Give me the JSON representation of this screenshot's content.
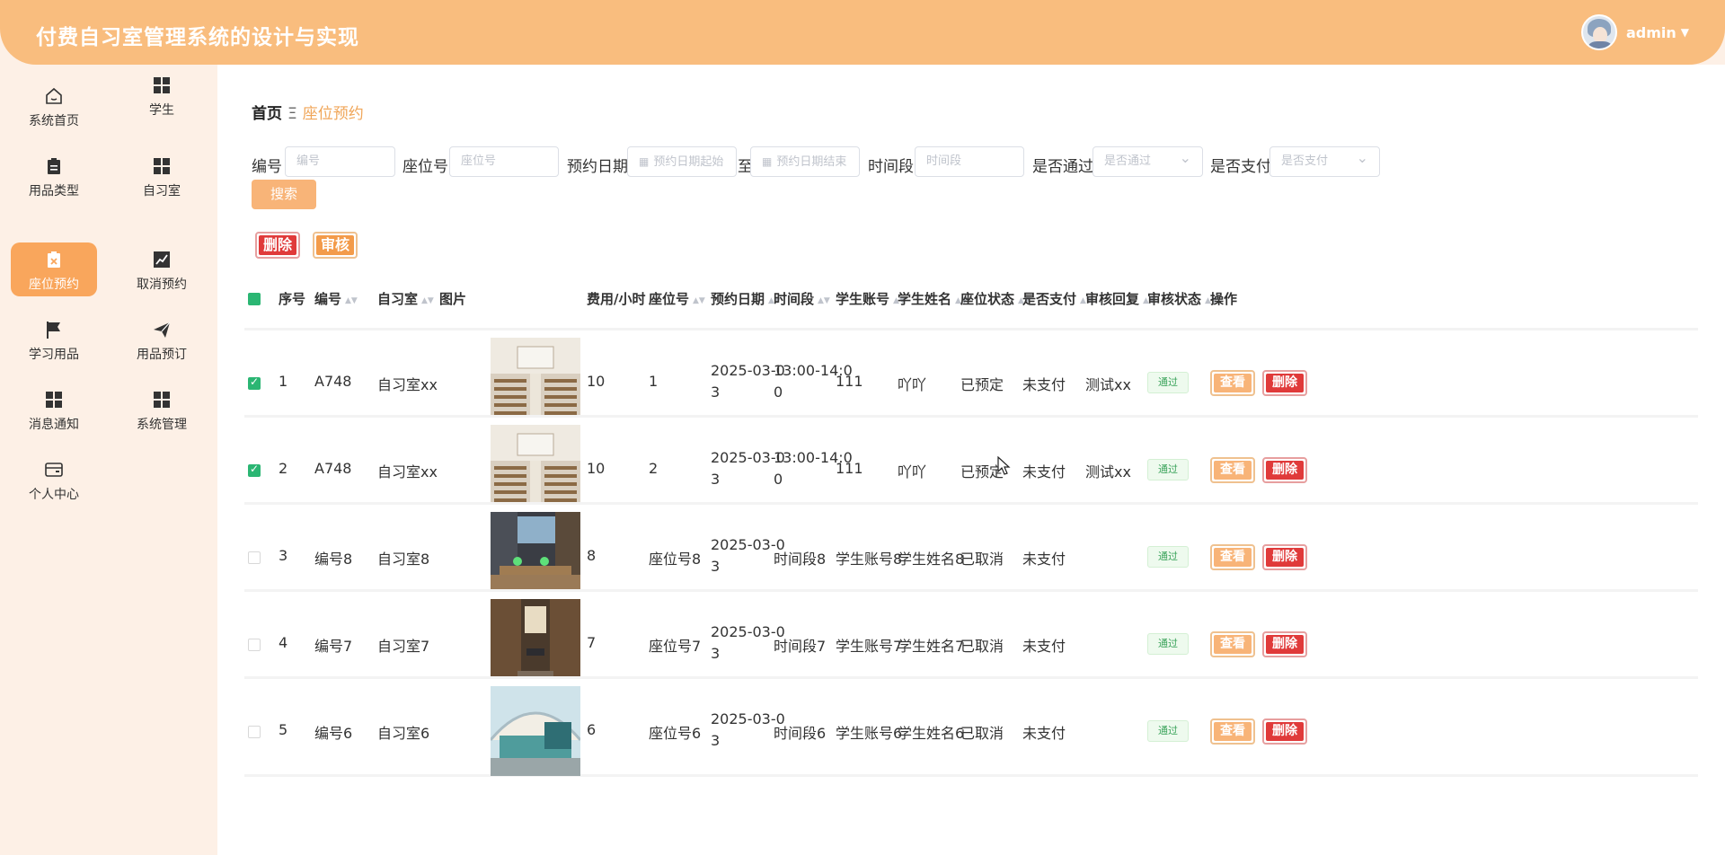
{
  "app": {
    "title": "付费自习室管理系统的设计与实现",
    "username": "admin"
  },
  "sidebar": {
    "items": [
      {
        "label": "系统首页",
        "icon": "home-icon"
      },
      {
        "label": "学生",
        "icon": "grid-icon"
      },
      {
        "label": "用品类型",
        "icon": "clipboard-icon"
      },
      {
        "label": "自习室",
        "icon": "grid-icon"
      },
      {
        "label": "座位预约",
        "icon": "clipboard-x-icon",
        "active": true
      },
      {
        "label": "取消预约",
        "icon": "trend-chart-icon"
      },
      {
        "label": "学习用品",
        "icon": "flag-icon"
      },
      {
        "label": "用品预订",
        "icon": "send-icon"
      },
      {
        "label": "消息通知",
        "icon": "grid-icon"
      },
      {
        "label": "系统管理",
        "icon": "grid-icon"
      },
      {
        "label": "个人中心",
        "icon": "card-icon"
      }
    ]
  },
  "breadcrumb": {
    "home": "首页",
    "separator": "Ξ",
    "current": "座位预约"
  },
  "search": {
    "fields": [
      {
        "label": "编号",
        "placeholder": "编号"
      },
      {
        "label": "座位号",
        "placeholder": "座位号"
      },
      {
        "label": "预约日期",
        "placeholder_start": "预约日期起始",
        "separator": "至",
        "placeholder_end": "预约日期结束"
      },
      {
        "label": "时间段",
        "placeholder": "时间段"
      },
      {
        "label": "是否通过",
        "placeholder": "是否通过"
      },
      {
        "label": "是否支付",
        "placeholder": "是否支付"
      }
    ],
    "button": "搜索"
  },
  "actions": {
    "batch_delete": "删除",
    "batch_audit": "审核"
  },
  "table": {
    "columns": [
      "序号",
      "编号",
      "自习室",
      "图片",
      "费用/小时",
      "座位号",
      "预约日期",
      "时间段",
      "学生账号",
      "学生姓名",
      "座位状态",
      "是否支付",
      "审核回复",
      "审核状态",
      "操作"
    ],
    "row_actions": {
      "view": "查看",
      "delete": "删除"
    },
    "rows": [
      {
        "checked": true,
        "index": "1",
        "code": "A748",
        "room": "自习室xx",
        "image": "classroom",
        "fee": "10",
        "seat": "1",
        "date_line1": "2025-03-0",
        "date_line2": "3",
        "time_line1": "13:00-14:0",
        "time_line2": "0",
        "account": "111",
        "name": "吖吖",
        "seat_status": "已预定",
        "paid": "未支付",
        "reply": "测试xx",
        "audit": "通过"
      },
      {
        "checked": true,
        "index": "2",
        "code": "A748",
        "room": "自习室xx",
        "image": "classroom",
        "fee": "10",
        "seat": "2",
        "date_line1": "2025-03-0",
        "date_line2": "3",
        "time_line1": "13:00-14:0",
        "time_line2": "0",
        "account": "111",
        "name": "吖吖",
        "seat_status": "已预定",
        "paid": "未支付",
        "reply": "测试xx",
        "audit": "通过"
      },
      {
        "checked": false,
        "index": "3",
        "code": "编号8",
        "room": "自习室8",
        "image": "library-desks",
        "fee": "8",
        "seat": "座位号8",
        "date_line1": "2025-03-0",
        "date_line2": "3",
        "time_line1": "时间段8",
        "time_line2": "",
        "account": "学生账号8",
        "name": "学生姓名8",
        "seat_status": "已取消",
        "paid": "未支付",
        "reply": "",
        "audit": "通过"
      },
      {
        "checked": false,
        "index": "4",
        "code": "编号7",
        "room": "自习室7",
        "image": "library-hall",
        "fee": "7",
        "seat": "座位号7",
        "date_line1": "2025-03-0",
        "date_line2": "3",
        "time_line1": "时间段7",
        "time_line2": "",
        "account": "学生账号7",
        "name": "学生姓名7",
        "seat_status": "已取消",
        "paid": "未支付",
        "reply": "",
        "audit": "通过"
      },
      {
        "checked": false,
        "index": "5",
        "code": "编号6",
        "room": "自习室6",
        "image": "modern-library",
        "fee": "6",
        "seat": "座位号6",
        "date_line1": "2025-03-0",
        "date_line2": "3",
        "time_line1": "时间段6",
        "time_line2": "",
        "account": "学生账号6",
        "name": "学生姓名6",
        "seat_status": "已取消",
        "paid": "未支付",
        "reply": "",
        "audit": "通过"
      }
    ]
  },
  "colors": {
    "header": "#f9bd7e",
    "accent": "#f9a65c",
    "danger": "#e03a3a",
    "success": "#2bb673",
    "sidebar_bg": "#fdf0e6"
  }
}
